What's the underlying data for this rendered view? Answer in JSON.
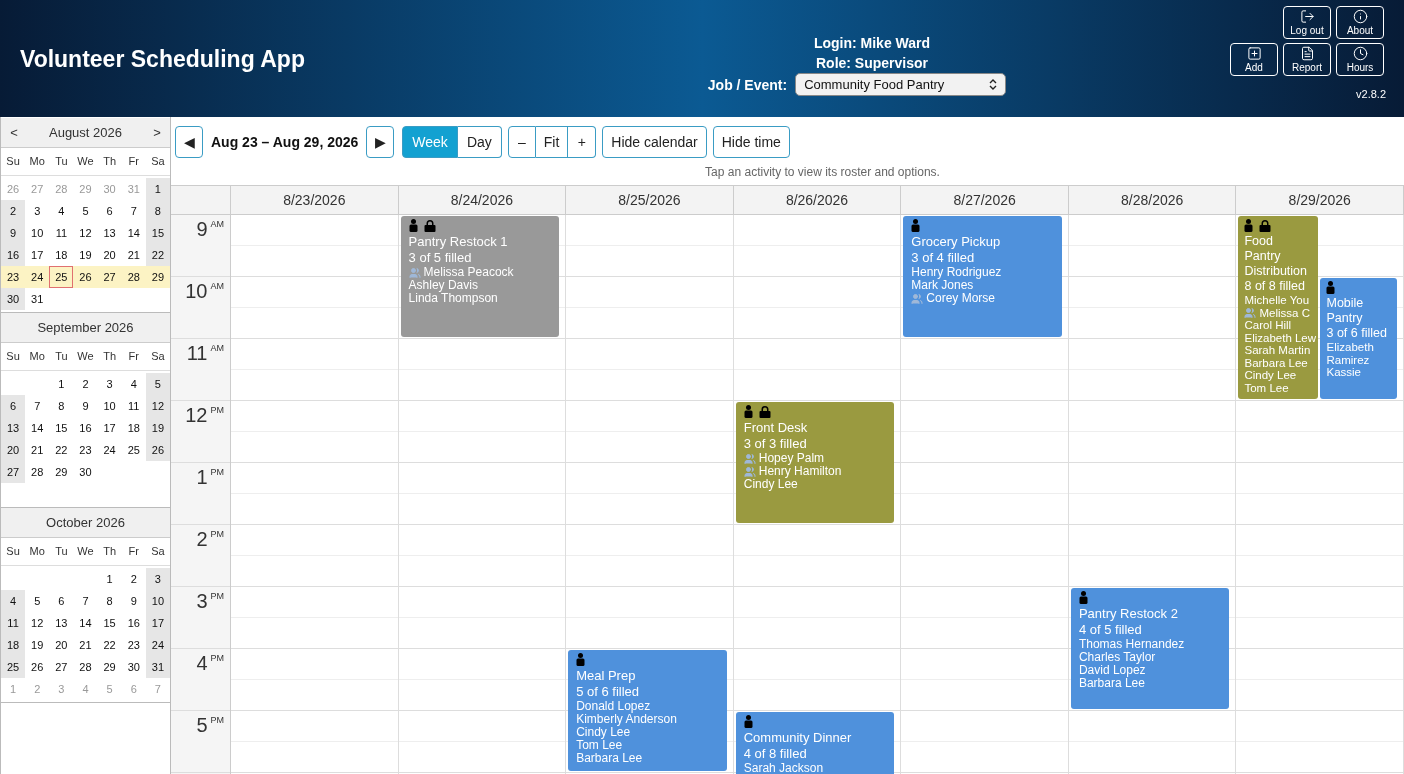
{
  "header": {
    "title": "Volunteer Scheduling App",
    "login": "Login: Mike Ward",
    "role": "Role: Supervisor",
    "job_label": "Job / Event:",
    "job_select": "Community Food Pantry",
    "buttons_top": [
      {
        "kind": "logout",
        "label": "Log out"
      },
      {
        "kind": "about",
        "label": "About"
      }
    ],
    "buttons_bottom": [
      {
        "kind": "add",
        "label": "Add"
      },
      {
        "kind": "report",
        "label": "Report"
      },
      {
        "kind": "hours",
        "label": "Hours"
      }
    ],
    "version": "v2.8.2"
  },
  "mini_calendars": [
    {
      "title": "August 2026",
      "prev": "<",
      "next": ">",
      "weekdays": [
        "Su",
        "Mo",
        "Tu",
        "We",
        "Th",
        "Fr",
        "Sa"
      ],
      "weeks": [
        {
          "selected": false,
          "kind": "full",
          "days": [
            {
              "n": "26",
              "muted": true,
              "today": false
            },
            {
              "n": "27",
              "muted": true,
              "today": false
            },
            {
              "n": "28",
              "muted": true,
              "today": false
            },
            {
              "n": "29",
              "muted": true,
              "today": false
            },
            {
              "n": "30",
              "muted": true,
              "today": false
            },
            {
              "n": "31",
              "muted": true,
              "today": false
            },
            {
              "n": "1",
              "muted": false,
              "today": false
            }
          ]
        },
        {
          "selected": false,
          "kind": "full",
          "days": [
            {
              "n": "2",
              "muted": false,
              "today": false
            },
            {
              "n": "3",
              "muted": false,
              "today": false
            },
            {
              "n": "4",
              "muted": false,
              "today": false
            },
            {
              "n": "5",
              "muted": false,
              "today": false
            },
            {
              "n": "6",
              "muted": false,
              "today": false
            },
            {
              "n": "7",
              "muted": false,
              "today": false
            },
            {
              "n": "8",
              "muted": false,
              "today": false
            }
          ]
        },
        {
          "selected": false,
          "kind": "full",
          "days": [
            {
              "n": "9",
              "muted": false,
              "today": false
            },
            {
              "n": "10",
              "muted": false,
              "today": false
            },
            {
              "n": "11",
              "muted": false,
              "today": false
            },
            {
              "n": "12",
              "muted": false,
              "today": false
            },
            {
              "n": "13",
              "muted": false,
              "today": false
            },
            {
              "n": "14",
              "muted": false,
              "today": false
            },
            {
              "n": "15",
              "muted": false,
              "today": false
            }
          ]
        },
        {
          "selected": false,
          "kind": "full",
          "days": [
            {
              "n": "16",
              "muted": false,
              "today": false
            },
            {
              "n": "17",
              "muted": false,
              "today": false
            },
            {
              "n": "18",
              "muted": false,
              "today": false
            },
            {
              "n": "19",
              "muted": false,
              "today": false
            },
            {
              "n": "20",
              "muted": false,
              "today": false
            },
            {
              "n": "21",
              "muted": false,
              "today": false
            },
            {
              "n": "22",
              "muted": false,
              "today": false
            }
          ]
        },
        {
          "selected": true,
          "kind": "full",
          "days": [
            {
              "n": "23",
              "muted": false,
              "today": false
            },
            {
              "n": "24",
              "muted": false,
              "today": false
            },
            {
              "n": "25",
              "muted": false,
              "today": true
            },
            {
              "n": "26",
              "muted": false,
              "today": false
            },
            {
              "n": "27",
              "muted": false,
              "today": false
            },
            {
              "n": "28",
              "muted": false,
              "today": false
            },
            {
              "n": "29",
              "muted": false,
              "today": false
            }
          ]
        },
        {
          "selected": false,
          "kind": "start",
          "days": [
            {
              "n": "30",
              "muted": false,
              "today": false
            },
            {
              "n": "31",
              "muted": false,
              "today": false
            }
          ]
        }
      ]
    },
    {
      "title": "September 2026",
      "weekdays": [
        "Su",
        "Mo",
        "Tu",
        "We",
        "Th",
        "Fr",
        "Sa"
      ],
      "weeks": [
        {
          "selected": false,
          "kind": "end",
          "days": [
            {
              "n": "1",
              "muted": false,
              "today": false
            },
            {
              "n": "2",
              "muted": false,
              "today": false
            },
            {
              "n": "3",
              "muted": false,
              "today": false
            },
            {
              "n": "4",
              "muted": false,
              "today": false
            },
            {
              "n": "5",
              "muted": false,
              "today": false
            }
          ]
        },
        {
          "selected": false,
          "kind": "full",
          "days": [
            {
              "n": "6",
              "muted": false,
              "today": false
            },
            {
              "n": "7",
              "muted": false,
              "today": false
            },
            {
              "n": "8",
              "muted": false,
              "today": false
            },
            {
              "n": "9",
              "muted": false,
              "today": false
            },
            {
              "n": "10",
              "muted": false,
              "today": false
            },
            {
              "n": "11",
              "muted": false,
              "today": false
            },
            {
              "n": "12",
              "muted": false,
              "today": false
            }
          ]
        },
        {
          "selected": false,
          "kind": "full",
          "days": [
            {
              "n": "13",
              "muted": false,
              "today": false
            },
            {
              "n": "14",
              "muted": false,
              "today": false
            },
            {
              "n": "15",
              "muted": false,
              "today": false
            },
            {
              "n": "16",
              "muted": false,
              "today": false
            },
            {
              "n": "17",
              "muted": false,
              "today": false
            },
            {
              "n": "18",
              "muted": false,
              "today": false
            },
            {
              "n": "19",
              "muted": false,
              "today": false
            }
          ]
        },
        {
          "selected": false,
          "kind": "full",
          "days": [
            {
              "n": "20",
              "muted": false,
              "today": false
            },
            {
              "n": "21",
              "muted": false,
              "today": false
            },
            {
              "n": "22",
              "muted": false,
              "today": false
            },
            {
              "n": "23",
              "muted": false,
              "today": false
            },
            {
              "n": "24",
              "muted": false,
              "today": false
            },
            {
              "n": "25",
              "muted": false,
              "today": false
            },
            {
              "n": "26",
              "muted": false,
              "today": false
            }
          ]
        },
        {
          "selected": false,
          "kind": "start",
          "days": [
            {
              "n": "27",
              "muted": false,
              "today": false
            },
            {
              "n": "28",
              "muted": false,
              "today": false
            },
            {
              "n": "29",
              "muted": false,
              "today": false
            },
            {
              "n": "30",
              "muted": false,
              "today": false
            }
          ]
        }
      ]
    },
    {
      "title": "October 2026",
      "weekdays": [
        "Su",
        "Mo",
        "Tu",
        "We",
        "Th",
        "Fr",
        "Sa"
      ],
      "weeks": [
        {
          "selected": false,
          "kind": "end",
          "days": [
            {
              "n": "1",
              "muted": false,
              "today": false
            },
            {
              "n": "2",
              "muted": false,
              "today": false
            },
            {
              "n": "3",
              "muted": false,
              "today": false
            }
          ]
        },
        {
          "selected": false,
          "kind": "full",
          "days": [
            {
              "n": "4",
              "muted": false,
              "today": false
            },
            {
              "n": "5",
              "muted": false,
              "today": false
            },
            {
              "n": "6",
              "muted": false,
              "today": false
            },
            {
              "n": "7",
              "muted": false,
              "today": false
            },
            {
              "n": "8",
              "muted": false,
              "today": false
            },
            {
              "n": "9",
              "muted": false,
              "today": false
            },
            {
              "n": "10",
              "muted": false,
              "today": false
            }
          ]
        },
        {
          "selected": false,
          "kind": "full",
          "days": [
            {
              "n": "11",
              "muted": false,
              "today": false
            },
            {
              "n": "12",
              "muted": false,
              "today": false
            },
            {
              "n": "13",
              "muted": false,
              "today": false
            },
            {
              "n": "14",
              "muted": false,
              "today": false
            },
            {
              "n": "15",
              "muted": false,
              "today": false
            },
            {
              "n": "16",
              "muted": false,
              "today": false
            },
            {
              "n": "17",
              "muted": false,
              "today": false
            }
          ]
        },
        {
          "selected": false,
          "kind": "full",
          "days": [
            {
              "n": "18",
              "muted": false,
              "today": false
            },
            {
              "n": "19",
              "muted": false,
              "today": false
            },
            {
              "n": "20",
              "muted": false,
              "today": false
            },
            {
              "n": "21",
              "muted": false,
              "today": false
            },
            {
              "n": "22",
              "muted": false,
              "today": false
            },
            {
              "n": "23",
              "muted": false,
              "today": false
            },
            {
              "n": "24",
              "muted": false,
              "today": false
            }
          ]
        },
        {
          "selected": false,
          "kind": "full",
          "days": [
            {
              "n": "25",
              "muted": false,
              "today": false
            },
            {
              "n": "26",
              "muted": false,
              "today": false
            },
            {
              "n": "27",
              "muted": false,
              "today": false
            },
            {
              "n": "28",
              "muted": false,
              "today": false
            },
            {
              "n": "29",
              "muted": false,
              "today": false
            },
            {
              "n": "30",
              "muted": false,
              "today": false
            },
            {
              "n": "31",
              "muted": false,
              "today": false
            }
          ]
        },
        {
          "selected": false,
          "kind": "full",
          "days": [
            {
              "n": "1",
              "muted": true,
              "today": false
            },
            {
              "n": "2",
              "muted": true,
              "today": false
            },
            {
              "n": "3",
              "muted": true,
              "today": false
            },
            {
              "n": "4",
              "muted": true,
              "today": false
            },
            {
              "n": "5",
              "muted": true,
              "today": false
            },
            {
              "n": "6",
              "muted": true,
              "today": false
            },
            {
              "n": "7",
              "muted": true,
              "today": false
            }
          ]
        }
      ]
    }
  ],
  "toolbar": {
    "prev": "◀",
    "range": "Aug 23 – Aug 29, 2026",
    "next": "▶",
    "views": [
      {
        "label": "Week",
        "selected": true
      },
      {
        "label": "Day",
        "selected": false
      }
    ],
    "zoom": [
      "–",
      "Fit",
      "+"
    ],
    "hide_calendar": "Hide calendar",
    "hide_time": "Hide time",
    "hint": "Tap an activity to view its roster and options."
  },
  "hours": [
    {
      "hour": "9",
      "period": "AM"
    },
    {
      "hour": "10",
      "period": "AM"
    },
    {
      "hour": "11",
      "period": "AM"
    },
    {
      "hour": "12",
      "period": "PM"
    },
    {
      "hour": "1",
      "period": "PM"
    },
    {
      "hour": "2",
      "period": "PM"
    },
    {
      "hour": "3",
      "period": "PM"
    },
    {
      "hour": "4",
      "period": "PM"
    },
    {
      "hour": "5",
      "period": "PM"
    }
  ],
  "days": [
    {
      "date": "8/23/2026",
      "slots": [
        {
          "kind": "open"
        },
        {
          "kind": "open"
        },
        {
          "kind": "open"
        },
        {
          "kind": "open"
        },
        {
          "kind": "open"
        },
        {
          "kind": "open"
        },
        {
          "kind": "open"
        },
        {
          "kind": "open"
        },
        {
          "kind": "open"
        }
      ]
    },
    {
      "date": "8/24/2026",
      "slots": [
        {
          "kind": "start",
          "events": [
            {
              "kind": "double",
              "title": "Pantry Restock 1",
              "filled": "3 of 5 filled",
              "color": "#999999",
              "locked": true,
              "people": [
                {
                  "name": "Melissa Peacock",
                  "group": true
                },
                {
                  "name": "Ashley Davis",
                  "group": false
                },
                {
                  "name": "Linda Thompson",
                  "group": false
                }
              ]
            }
          ]
        },
        {
          "kind": "taken"
        },
        {
          "kind": "open"
        },
        {
          "kind": "open"
        },
        {
          "kind": "open"
        },
        {
          "kind": "open"
        },
        {
          "kind": "open"
        },
        {
          "kind": "open"
        },
        {
          "kind": "open"
        }
      ]
    },
    {
      "date": "8/25/2026",
      "slots": [
        {
          "kind": "open"
        },
        {
          "kind": "open"
        },
        {
          "kind": "open"
        },
        {
          "kind": "open"
        },
        {
          "kind": "open"
        },
        {
          "kind": "open"
        },
        {
          "kind": "open"
        },
        {
          "kind": "start",
          "events": [
            {
              "kind": "double",
              "title": "Meal Prep",
              "filled": "5 of 6 filled",
              "color": "#4f91dc",
              "locked": false,
              "people": [
                {
                  "name": "Donald Lopez",
                  "group": false
                },
                {
                  "name": "Kimberly Anderson",
                  "group": false
                },
                {
                  "name": "Cindy Lee",
                  "group": false
                },
                {
                  "name": "Tom Lee",
                  "group": false
                },
                {
                  "name": "Barbara Lee",
                  "group": false
                }
              ]
            }
          ]
        },
        {
          "kind": "taken"
        }
      ]
    },
    {
      "date": "8/26/2026",
      "slots": [
        {
          "kind": "open"
        },
        {
          "kind": "open"
        },
        {
          "kind": "open"
        },
        {
          "kind": "start",
          "events": [
            {
              "kind": "double",
              "title": "Front Desk",
              "filled": "3 of 3 filled",
              "color": "#9a9a40",
              "locked": true,
              "people": [
                {
                  "name": "Hopey Palm",
                  "group": true
                },
                {
                  "name": "Henry Hamilton",
                  "group": true
                },
                {
                  "name": "Cindy Lee",
                  "group": false
                }
              ]
            }
          ]
        },
        {
          "kind": "taken"
        },
        {
          "kind": "open"
        },
        {
          "kind": "open"
        },
        {
          "kind": "open"
        },
        {
          "kind": "start",
          "events": [
            {
              "kind": "double",
              "title": "Community Dinner",
              "filled": "4 of 8 filled",
              "color": "#4f91dc",
              "locked": false,
              "people": [
                {
                  "name": "Sarah Jackson",
                  "group": false
                }
              ]
            }
          ]
        }
      ]
    },
    {
      "date": "8/27/2026",
      "slots": [
        {
          "kind": "start",
          "events": [
            {
              "kind": "double",
              "title": "Grocery Pickup",
              "filled": "3 of 4 filled",
              "color": "#4f91dc",
              "locked": false,
              "people": [
                {
                  "name": "Henry Rodriguez",
                  "group": false
                },
                {
                  "name": "Mark Jones",
                  "group": false
                },
                {
                  "name": "Corey Morse",
                  "group": true
                }
              ]
            }
          ]
        },
        {
          "kind": "taken"
        },
        {
          "kind": "open"
        },
        {
          "kind": "open"
        },
        {
          "kind": "open"
        },
        {
          "kind": "open"
        },
        {
          "kind": "open"
        },
        {
          "kind": "open"
        },
        {
          "kind": "open"
        }
      ]
    },
    {
      "date": "8/28/2026",
      "slots": [
        {
          "kind": "open"
        },
        {
          "kind": "open"
        },
        {
          "kind": "open"
        },
        {
          "kind": "open"
        },
        {
          "kind": "open"
        },
        {
          "kind": "open"
        },
        {
          "kind": "start",
          "events": [
            {
              "kind": "double",
              "title": "Pantry Restock 2",
              "filled": "4 of 5 filled",
              "color": "#4f91dc",
              "locked": false,
              "people": [
                {
                  "name": "Thomas Hernandez",
                  "group": false
                },
                {
                  "name": "Charles Taylor",
                  "group": false
                },
                {
                  "name": "David Lopez",
                  "group": false
                },
                {
                  "name": "Barbara Lee",
                  "group": false
                }
              ]
            }
          ]
        },
        {
          "kind": "taken"
        },
        {
          "kind": "open"
        }
      ]
    },
    {
      "date": "8/29/2026",
      "slots": [
        {
          "kind": "start",
          "events": [
            {
              "kind": "triple",
              "title": "Food Pantry Distribution",
              "filled": "8 of 8 filled",
              "color": "#9a9a40",
              "locked": true,
              "people": [
                {
                  "name": "Michelle You",
                  "group": false
                },
                {
                  "name": "Melissa C",
                  "group": true
                },
                {
                  "name": "Carol Hill",
                  "group": false
                },
                {
                  "name": "Elizabeth Lew",
                  "group": false
                },
                {
                  "name": "Sarah Martin",
                  "group": false
                },
                {
                  "name": "Barbara Lee",
                  "group": false
                },
                {
                  "name": "Cindy Lee",
                  "group": false
                },
                {
                  "name": "Tom Lee",
                  "group": false
                }
              ]
            }
          ]
        },
        {
          "kind": "start",
          "events": [
            {
              "kind": "double",
              "title": "Mobile Pantry",
              "filled": "3 of 6 filled",
              "color": "#4f91dc",
              "locked": false,
              "people": [
                {
                  "name": "Elizabeth Ramirez",
                  "group": false
                },
                {
                  "name": "Kassie",
                  "group": false
                }
              ]
            }
          ]
        },
        {
          "kind": "taken"
        },
        {
          "kind": "open"
        },
        {
          "kind": "open"
        },
        {
          "kind": "open"
        },
        {
          "kind": "open"
        },
        {
          "kind": "open"
        },
        {
          "kind": "open"
        }
      ]
    }
  ]
}
